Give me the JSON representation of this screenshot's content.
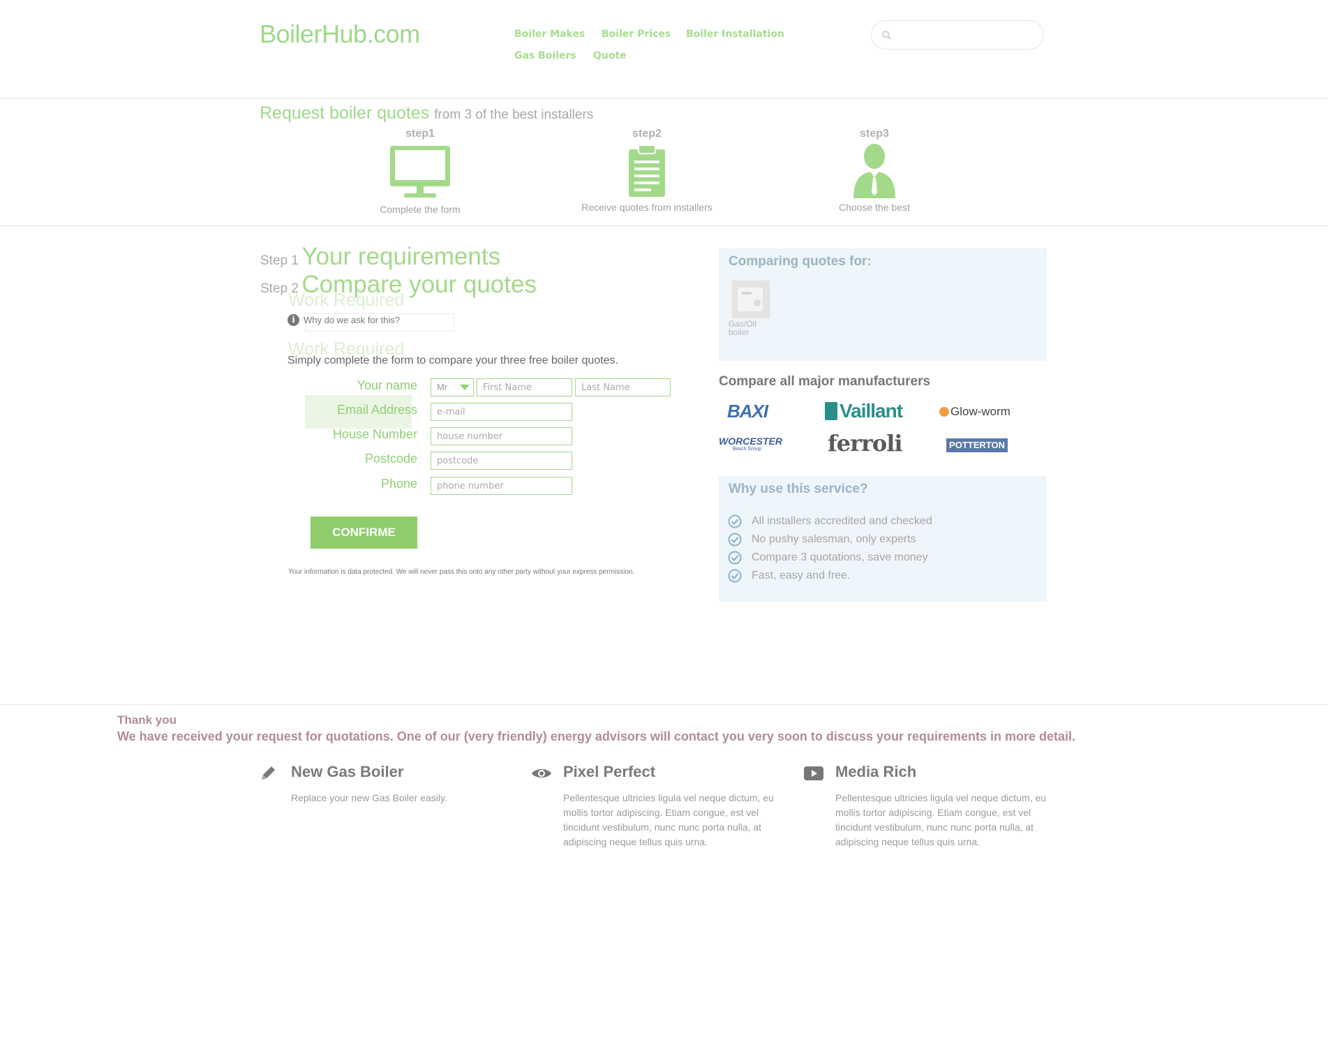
{
  "header": {
    "logo": "BoilerHub.com",
    "nav": [
      "Boiler Makes",
      "Boiler Prices",
      "Boiler Installation",
      "Gas Boilers",
      "Quote"
    ],
    "search_placeholder": ""
  },
  "banner": {
    "title": "Request boiler quotes",
    "subtitle": "from 3 of the best installers",
    "steps": [
      {
        "label": "step1",
        "caption": "Complete the form",
        "icon": "monitor-icon"
      },
      {
        "label": "step2",
        "caption": "Receive quotes from installers",
        "icon": "clipboard-icon"
      },
      {
        "label": "step3",
        "caption": "Choose the best",
        "icon": "person-icon"
      }
    ]
  },
  "form": {
    "step1_prefix": "Step 1",
    "step1_title": "Your requirements",
    "step2_prefix": "Step 2",
    "step2_title": "Compare your quotes",
    "ghost_work_required": "Work Required",
    "info": "Why do we ask for this?",
    "lead": "Simply complete the form to compare your three free boiler quotes.",
    "labels": {
      "name": "Your name",
      "email": "Email Address",
      "house": "House Number",
      "postcode": "Postcode",
      "phone": "Phone"
    },
    "title_value": "Mr",
    "placeholders": {
      "first": "First Name",
      "last": "Last Name",
      "email": "e-mail",
      "house": "house number",
      "postcode": "postcode",
      "phone": "phone number"
    },
    "confirm": "CONFIRME",
    "privacy": "Your information is data protected. We will never pass this onto any other party without your express permission."
  },
  "sidebar": {
    "comparing_title": "Comparing quotes for:",
    "comparing_item": "Gas/Oil boiler",
    "manufacturers_title": "Compare all major manufacturers",
    "brands": [
      "BAXI",
      "Vaillant",
      "Glow-worm",
      "WORCESTER",
      "ferroli",
      "POTTERTON"
    ],
    "worcester_sub": "Bosch Group",
    "why_title": "Why use this service?",
    "why_items": [
      "All installers accredited and checked",
      "No pushy salesman, only experts",
      "Compare 3 quotations, save money",
      "Fast, easy and free."
    ]
  },
  "thanks": {
    "title": "Thank you",
    "message": "We have received your request for quotations. One of our (very friendly) energy advisors will contact you very soon to discuss your requirements in more detail."
  },
  "features": [
    {
      "icon": "pencil-icon",
      "title": "New Gas Boiler",
      "text": "Replace your new Gas Boiler easily."
    },
    {
      "icon": "eye-icon",
      "title": "Pixel Perfect",
      "text": "Pellentesque ultricies ligula vel neque dictum, eu mollis tortor adipiscing. Etiam congue, est vel tincidunt vestibulum, nunc nunc porta nulla, at adipiscing neque tellus quis urna."
    },
    {
      "icon": "play-icon",
      "title": "Media Rich",
      "text": "Pellentesque ultricies ligula vel neque dictum, eu mollis tortor adipiscing. Etiam congue, est vel tincidunt vestibulum, nunc nunc porta nulla, at adipiscing neque tellus quis urna."
    }
  ],
  "colors": {
    "accent": "#9fd88a",
    "button": "#8ecd6a",
    "panel": "#eef5fb",
    "thanks": "#b08c96"
  }
}
